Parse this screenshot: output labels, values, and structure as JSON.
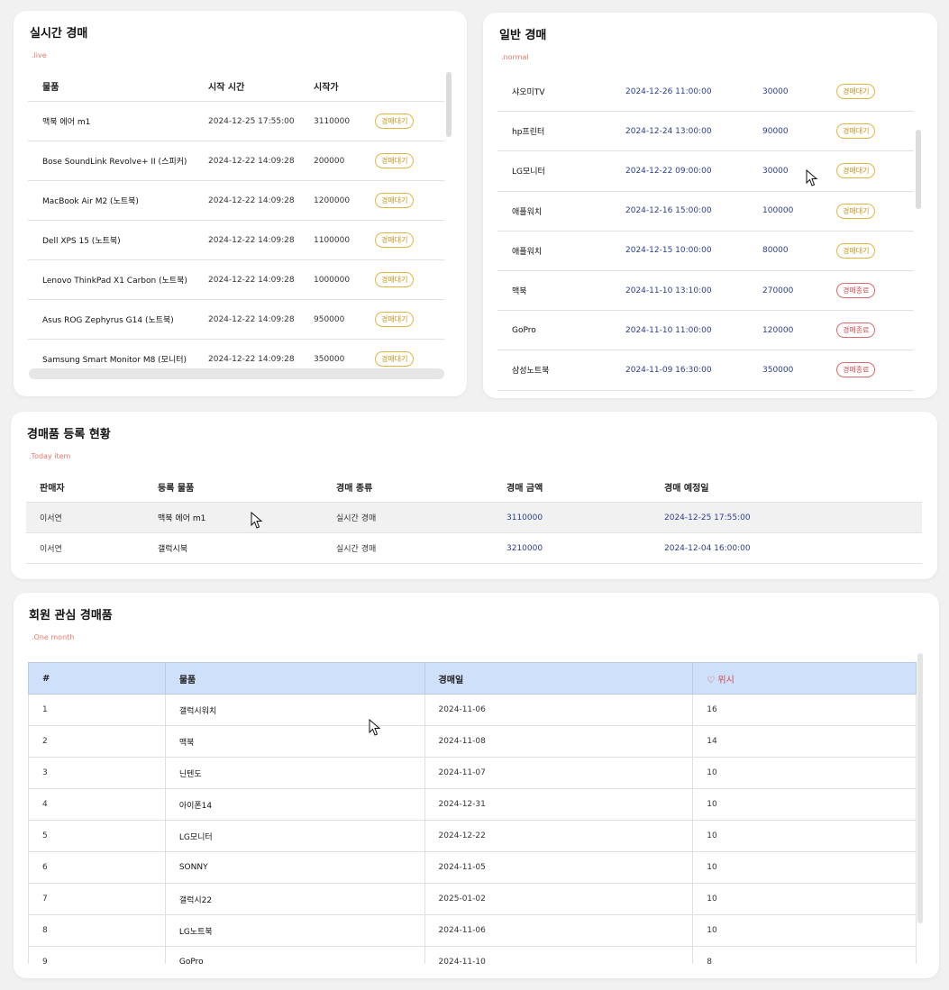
{
  "live": {
    "title": "실시간 경매",
    "subtitle": ".live",
    "headers": [
      "물품",
      "시작 시간",
      "시작가"
    ],
    "rows": [
      {
        "item": "맥북 에어 m1",
        "time": "2024-12-25 17:55:00",
        "price": "3110000",
        "status": "경매대기"
      },
      {
        "item": "Bose SoundLink Revolve+ II (스피커)",
        "time": "2024-12-22 14:09:28",
        "price": "200000",
        "status": "경매대기"
      },
      {
        "item": "MacBook Air M2 (노트북)",
        "time": "2024-12-22 14:09:28",
        "price": "1200000",
        "status": "경매대기"
      },
      {
        "item": "Dell XPS 15 (노트북)",
        "time": "2024-12-22 14:09:28",
        "price": "1100000",
        "status": "경매대기"
      },
      {
        "item": "Lenovo ThinkPad X1 Carbon (노트북)",
        "time": "2024-12-22 14:09:28",
        "price": "1000000",
        "status": "경매대기"
      },
      {
        "item": "Asus ROG Zephyrus G14 (노트북)",
        "time": "2024-12-22 14:09:28",
        "price": "950000",
        "status": "경매대기"
      },
      {
        "item": "Samsung Smart Monitor M8 (모니터)",
        "time": "2024-12-22 14:09:28",
        "price": "350000",
        "status": "경매대기"
      }
    ]
  },
  "normal": {
    "title": "일반 경매",
    "subtitle": ".normal",
    "rows": [
      {
        "item": "샤오미TV",
        "time": "2024-12-26 11:00:00",
        "price": "30000",
        "status": "경매대기"
      },
      {
        "item": "hp프린터",
        "time": "2024-12-24 13:00:00",
        "price": "90000",
        "status": "경매대기"
      },
      {
        "item": "LG모니터",
        "time": "2024-12-22 09:00:00",
        "price": "30000",
        "status": "경매대기"
      },
      {
        "item": "애플워치",
        "time": "2024-12-16 15:00:00",
        "price": "100000",
        "status": "경매대기"
      },
      {
        "item": "애플워치",
        "time": "2024-12-15 10:00:00",
        "price": "80000",
        "status": "경매대기"
      },
      {
        "item": "맥북",
        "time": "2024-11-10 13:10:00",
        "price": "270000",
        "status": "경매종료"
      },
      {
        "item": "GoPro",
        "time": "2024-11-10 11:00:00",
        "price": "120000",
        "status": "경매종료"
      },
      {
        "item": "삼성노트북",
        "time": "2024-11-09 16:30:00",
        "price": "350000",
        "status": "경매종료"
      }
    ]
  },
  "today": {
    "title": "경매품 등록 현황",
    "subtitle": ".Today item",
    "headers": [
      "판매자",
      "등록 물품",
      "경매 종류",
      "경매 금액",
      "경매 예정일"
    ],
    "rows": [
      {
        "seller": "이서연",
        "item": "맥북 에어 m1",
        "type": "실시간 경매",
        "amount": "3110000",
        "date": "2024-12-25 17:55:00"
      },
      {
        "seller": "이서연",
        "item": "갤럭시북",
        "type": "실시간 경매",
        "amount": "3210000",
        "date": "2024-12-04 16:00:00"
      }
    ]
  },
  "interest": {
    "title": "회원 관심 경매품",
    "subtitle": ".One month",
    "headers": [
      "#",
      "물품",
      "경매일",
      "위시"
    ],
    "rows": [
      {
        "no": "1",
        "item": "갤럭시워치",
        "date": "2024-11-06",
        "wish": "16"
      },
      {
        "no": "2",
        "item": "맥북",
        "date": "2024-11-08",
        "wish": "14"
      },
      {
        "no": "3",
        "item": "닌텐도",
        "date": "2024-11-07",
        "wish": "10"
      },
      {
        "no": "4",
        "item": "아이폰14",
        "date": "2024-12-31",
        "wish": "10"
      },
      {
        "no": "5",
        "item": "LG모니터",
        "date": "2024-12-22",
        "wish": "10"
      },
      {
        "no": "6",
        "item": "SONNY",
        "date": "2024-11-05",
        "wish": "10"
      },
      {
        "no": "7",
        "item": "갤럭시22",
        "date": "2025-01-02",
        "wish": "10"
      },
      {
        "no": "8",
        "item": "LG노트북",
        "date": "2024-11-06",
        "wish": "10"
      },
      {
        "no": "9",
        "item": "GoPro",
        "date": "2024-11-10",
        "wish": "8"
      }
    ]
  },
  "icons": {
    "wish": "heart-icon",
    "cursor": "mouse-cursor-icon"
  }
}
